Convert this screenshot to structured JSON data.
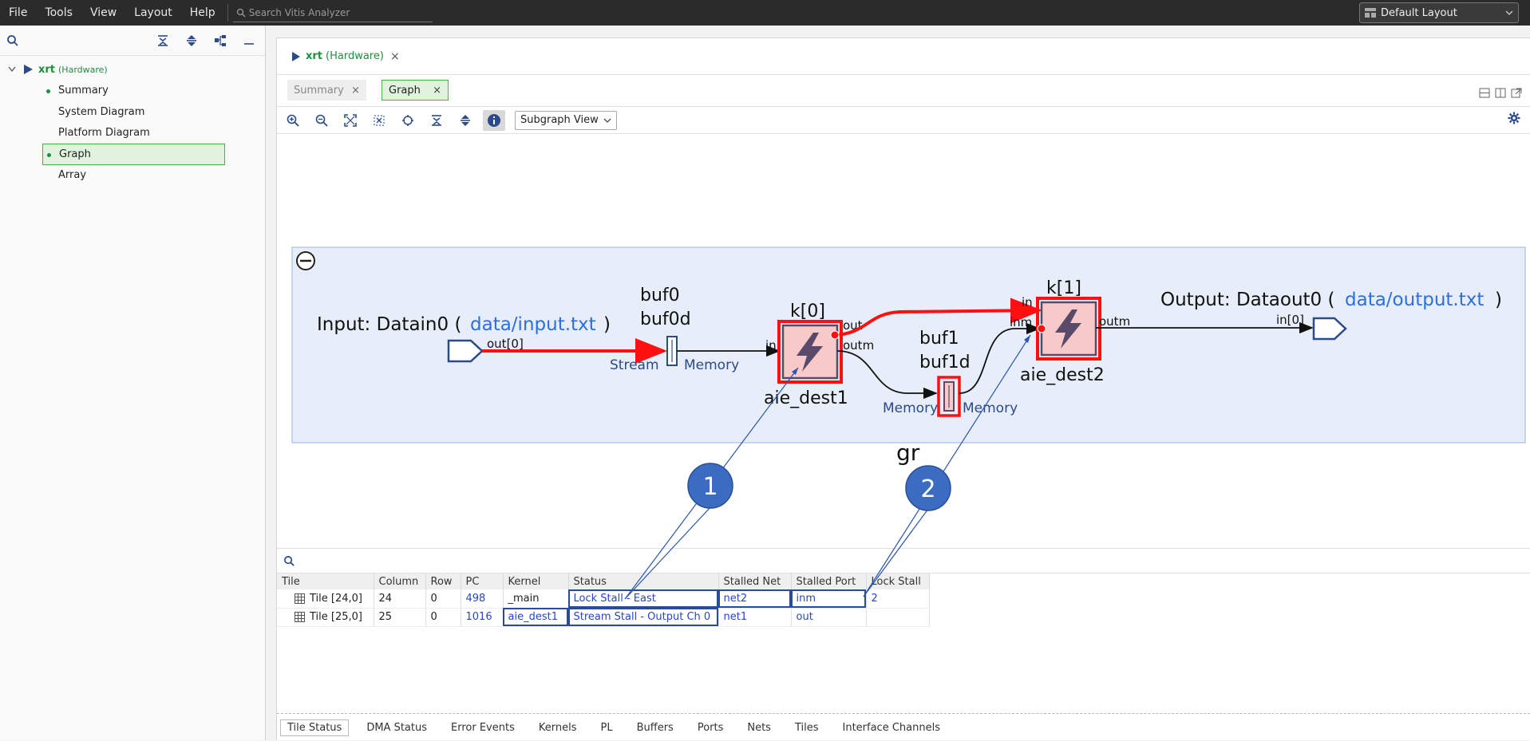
{
  "menubar": {
    "items": [
      "File",
      "Tools",
      "View",
      "Layout",
      "Help"
    ],
    "search_placeholder": "Search Vitis Analyzer",
    "layout_select": "Default Layout"
  },
  "left_panel": {
    "root": {
      "label": "xrt",
      "sub": "(Hardware)"
    },
    "items": [
      {
        "label": "Summary",
        "dot": true
      },
      {
        "label": "System Diagram",
        "dot": false
      },
      {
        "label": "Platform Diagram",
        "dot": false
      },
      {
        "label": "Graph",
        "dot": true,
        "selected": true
      },
      {
        "label": "Array",
        "dot": false
      }
    ]
  },
  "doc": {
    "title": "xrt",
    "sub": "(Hardware)",
    "close": "×"
  },
  "tabs": [
    {
      "label": "Summary",
      "close": "×"
    },
    {
      "label": "Graph",
      "close": "×"
    }
  ],
  "graph_toolbar": {
    "subgraph_view": "Subgraph View"
  },
  "graph": {
    "input_label": "Input: Datain0 (",
    "input_link": "data/input.txt",
    "input_close": ")",
    "input_port": "out[0]",
    "buf0": "buf0",
    "buf0d": "buf0d",
    "stream": "Stream",
    "memory": "Memory",
    "k0": "k[0]",
    "k0_in": "in",
    "k0_out": "out",
    "k0_outm": "outm",
    "aie_dest1": "aie_dest1",
    "buf1": "buf1",
    "buf1d": "buf1d",
    "k1": "k[1]",
    "k1_in": "in",
    "k1_inm": "inm",
    "k1_outm": "outm",
    "aie_dest2": "aie_dest2",
    "output_label": "Output: Dataout0 (",
    "output_link": "data/output.txt",
    "output_close": ")",
    "output_port": "in[0]",
    "gr": "gr",
    "callout1": "1",
    "callout2": "2"
  },
  "table": {
    "headers": [
      "Tile",
      "Column",
      "Row",
      "PC",
      "Kernel",
      "Status",
      "Stalled Net",
      "Stalled Port",
      "Lock Stall"
    ],
    "rows": [
      [
        "Tile [24,0]",
        "24",
        "0",
        "498",
        "_main",
        "Lock Stall - East",
        "net2",
        "inm",
        "2"
      ],
      [
        "Tile [25,0]",
        "25",
        "0",
        "1016",
        "aie_dest1",
        "Stream Stall - Output Ch 0",
        "net1",
        "out",
        ""
      ]
    ]
  },
  "bottom_tabs": [
    "Tile Status",
    "DMA Status",
    "Error Events",
    "Kernels",
    "PL",
    "Buffers",
    "Ports",
    "Nets",
    "Tiles",
    "Interface Channels"
  ],
  "colors": {
    "accent_green": "#1e8e3e",
    "link_blue": "#2a6ee8",
    "highlight_red": "#ff1010",
    "callout_blue": "#3b6cc2"
  }
}
